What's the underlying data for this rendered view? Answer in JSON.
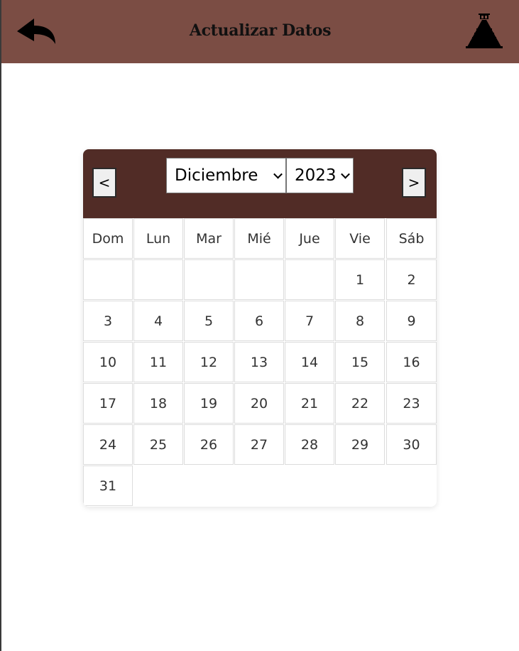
{
  "header": {
    "title": "Actualizar Datos",
    "back_icon": "back-arrow-icon",
    "logo_icon": "pyramid-logo-icon",
    "background": "#7b4d44"
  },
  "calendar": {
    "header_background": "#512c26",
    "prev_label": "<",
    "next_label": ">",
    "month": "Diciembre",
    "year": "2023",
    "weekdays": [
      "Dom",
      "Lun",
      "Mar",
      "Mié",
      "Jue",
      "Vie",
      "Sáb"
    ],
    "first_weekday_index": 5,
    "days": [
      "1",
      "2",
      "3",
      "4",
      "5",
      "6",
      "7",
      "8",
      "9",
      "10",
      "11",
      "12",
      "13",
      "14",
      "15",
      "16",
      "17",
      "18",
      "19",
      "20",
      "21",
      "22",
      "23",
      "24",
      "25",
      "26",
      "27",
      "28",
      "29",
      "30",
      "31"
    ]
  }
}
